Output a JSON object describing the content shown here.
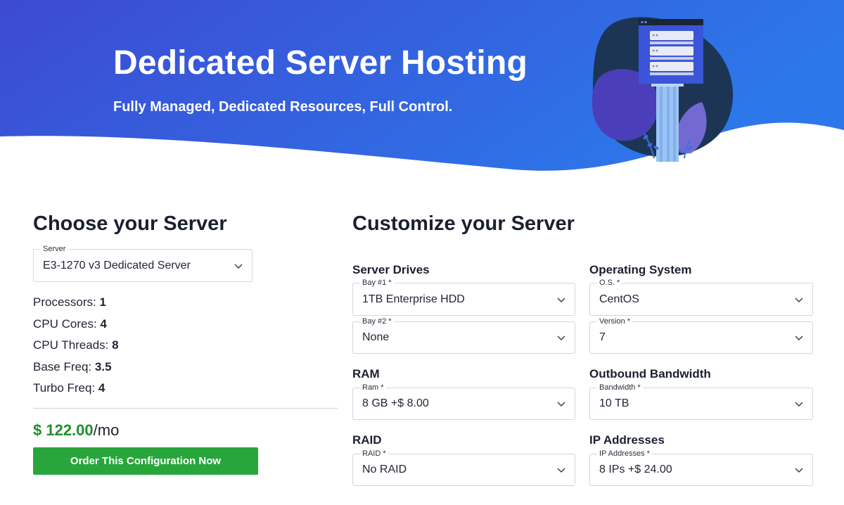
{
  "hero": {
    "title": "Dedicated Server Hosting",
    "subtitle": "Fully Managed, Dedicated Resources, Full Control.",
    "illustration_icon": "server-rack-illustration",
    "gradient_start": "#3c4fd6",
    "gradient_end": "#2f74e8"
  },
  "choose": {
    "title": "Choose your Server",
    "server_select": {
      "legend": "Server",
      "value": "E3-1270 v3 Dedicated Server"
    },
    "specs": [
      {
        "label": "Processors:",
        "value": "1"
      },
      {
        "label": "CPU Cores:",
        "value": "4"
      },
      {
        "label": "CPU Threads:",
        "value": "8"
      },
      {
        "label": "Base Freq:",
        "value": "3.5"
      },
      {
        "label": "Turbo Freq:",
        "value": "4"
      }
    ],
    "price": {
      "amount": "$ 122.00",
      "period": "/mo"
    },
    "order_button": "Order This Configuration Now",
    "accent_green": "#28a63b"
  },
  "customize": {
    "title": "Customize your Server",
    "server_drives": {
      "title": "Server Drives",
      "bay1": {
        "legend": "Bay #1 *",
        "value": "1TB Enterprise HDD"
      },
      "bay2": {
        "legend": "Bay #2 *",
        "value": "None"
      }
    },
    "operating_system": {
      "title": "Operating System",
      "os": {
        "legend": "O.S. *",
        "value": "CentOS"
      },
      "version": {
        "legend": "Version *",
        "value": "7"
      }
    },
    "ram": {
      "title": "RAM",
      "ram": {
        "legend": "Ram *",
        "value": "8 GB +$ 8.00"
      }
    },
    "bandwidth": {
      "title": "Outbound Bandwidth",
      "bandwidth": {
        "legend": "Bandwidth *",
        "value": "10 TB"
      }
    },
    "raid": {
      "title": "RAID",
      "raid": {
        "legend": "RAID *",
        "value": "No RAID"
      }
    },
    "ip": {
      "title": "IP Addresses",
      "ip": {
        "legend": "IP Addresses *",
        "value": "8 IPs +$ 24.00"
      }
    }
  }
}
